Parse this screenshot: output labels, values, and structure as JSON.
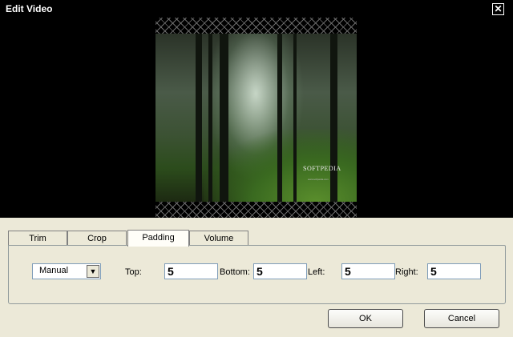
{
  "window": {
    "title": "Edit Video"
  },
  "icons": {
    "close": "close-icon",
    "dropdown": "chevron-down-icon"
  },
  "preview": {
    "watermark": "SOFTPEDIA",
    "watermark_sub": "www.softpedia.com"
  },
  "tabs": [
    {
      "label": "Trim",
      "active": false
    },
    {
      "label": "Crop",
      "active": false
    },
    {
      "label": "Padding",
      "active": true
    },
    {
      "label": "Volume",
      "active": false
    }
  ],
  "padding": {
    "mode": "Manual",
    "top_label": "Top:",
    "top_value": "5",
    "bottom_label": "Bottom:",
    "bottom_value": "5",
    "left_label": "Left:",
    "left_value": "5",
    "right_label": "Right:",
    "right_value": "5"
  },
  "buttons": {
    "ok": "OK",
    "cancel": "Cancel"
  },
  "colors": {
    "titlebar": "#000000",
    "dialog_bg": "#ece9d8",
    "input_border": "#7f9db9"
  }
}
